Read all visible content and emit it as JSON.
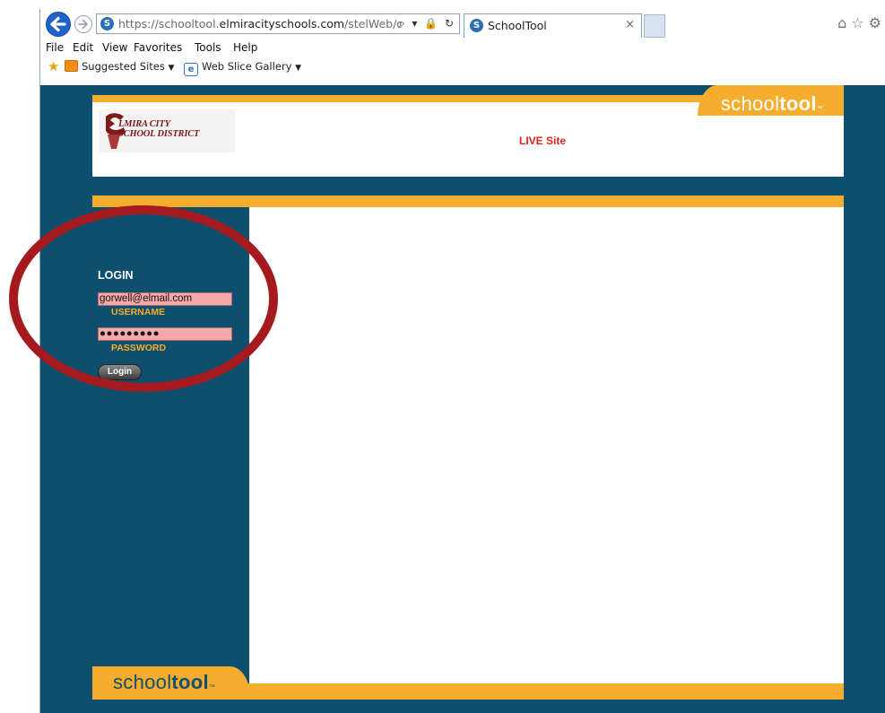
{
  "browser": {
    "url_prefix": "https://schooltool.",
    "url_domain": "elmiracityschools.com",
    "url_path": "/stelWeb/default.",
    "address_tools": "⌕ ▾ 🔒 ↻",
    "tab_title": "SchoolTool",
    "tab_close": "×",
    "right_icons": "⌂☆⚙"
  },
  "menu": {
    "items": [
      "File",
      "Edit",
      "View",
      "Favorites",
      "Tools",
      "Help"
    ]
  },
  "favorites": {
    "suggested": "Suggested Sites",
    "webslice": "Web Slice Gallery",
    "caret": "▼"
  },
  "header": {
    "district_line1": "LMIRA CITY",
    "district_line2": "SCHOOL DISTRICT",
    "live_label": "LIVE Site",
    "brand_light": "school",
    "brand_bold": "tool",
    "brand_tm": "™"
  },
  "login": {
    "heading": "LOGIN",
    "username_value": "gorwell@elmail.com",
    "username_label": "USERNAME",
    "password_mask": "●●●●●●●●●",
    "password_label": "PASSWORD",
    "button_label": "Login"
  },
  "footer": {
    "brand_light": "school",
    "brand_bold": "tool",
    "brand_tm": "™"
  },
  "colors": {
    "page_teal": "#0f4f6e",
    "accent_orange": "#f6ad2e",
    "live_red": "#e0231c",
    "annotation_red": "#a51a1f",
    "field_pink": "#f7a9a9"
  }
}
